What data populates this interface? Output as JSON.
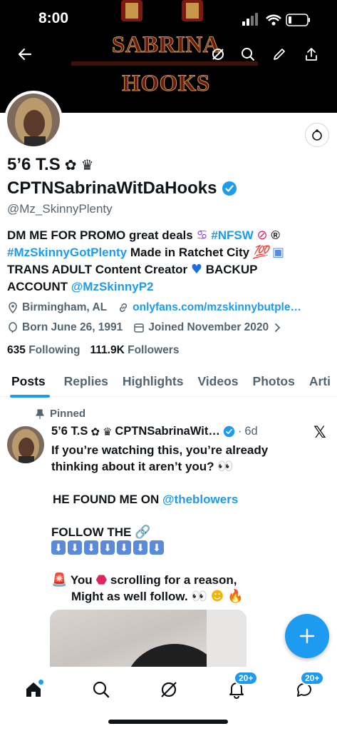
{
  "status_bar": {
    "time": "8:00"
  },
  "banner": {
    "title": "SABRINA HOOKS"
  },
  "profile": {
    "display_name_line1": "5’6 T.S",
    "display_name_line2": "CPTNSabrinaWitDaHooks",
    "handle": "@Mz_SkinnyPlenty",
    "bio": {
      "line1_text": "DM ME FOR PROMO great deals",
      "line1_tag": "#NFSW",
      "line1_symbol": "®",
      "line2_tag": "#MzSkinnyGotPlenty",
      "line2_text": "Made in Ratchet City",
      "line3_text": "TRANS ADULT Content Creator",
      "line3_text2": "BACKUP",
      "line4_text": "ACCOUNT",
      "line4_mention": "@MzSkinnyP2"
    },
    "location": "Birmingham, AL",
    "website": "onlyfans.com/mzskinnybutple…",
    "born": "Born June 26, 1991",
    "joined": "Joined November 2020",
    "following_count": "635",
    "following_label": "Following",
    "followers_count": "111.9K",
    "followers_label": "Followers"
  },
  "tabs": [
    "Posts",
    "Replies",
    "Highlights",
    "Videos",
    "Photos",
    "Arti"
  ],
  "pinned_post": {
    "pinned_label": "Pinned",
    "author_name": "5’6 T.S",
    "author_name2": "CPTNSabrinaWit…",
    "time": "6d",
    "line1": "If you’re watching this, you’re already",
    "line2": "thinking about it aren’t you?",
    "line3_text": "HE FOUND ME ON",
    "line3_mention": "@theblowers",
    "line4": "FOLLOW THE",
    "line5_a": "You",
    "line5_b": "scrolling for a reason,",
    "line6": "Might as well follow."
  },
  "bottom_nav": {
    "notifications_badge": "20+",
    "messages_badge": "20+"
  },
  "colors": {
    "accent": "#1d9bf0",
    "text": "#0f1419",
    "muted": "#536471"
  }
}
